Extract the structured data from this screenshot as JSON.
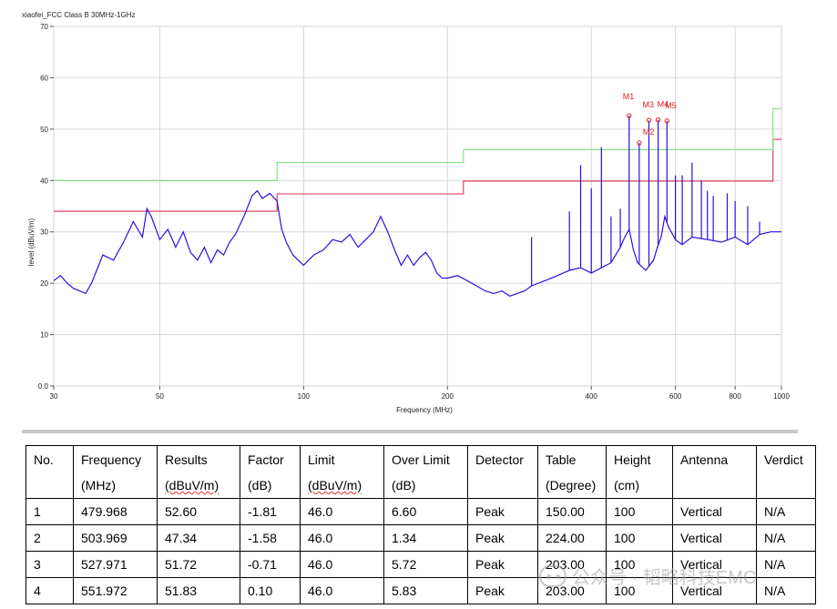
{
  "chart_data": {
    "type": "line",
    "title": "xiaofei_FCC Class B 30MHz-1GHz",
    "xlabel": "Frequency (MHz)",
    "ylabel": "level (dBuV/m)",
    "xscale": "log",
    "xlim": [
      30,
      1000
    ],
    "ylim": [
      0,
      70
    ],
    "grid": true,
    "x_ticks": [
      {
        "value": 30,
        "label": "30"
      },
      {
        "value": 50,
        "label": "50"
      },
      {
        "value": 100,
        "label": "100"
      },
      {
        "value": 200,
        "label": "200"
      },
      {
        "value": 400,
        "label": "400"
      },
      {
        "value": 600,
        "label": "600"
      },
      {
        "value": 800,
        "label": "800"
      },
      {
        "value": 1000,
        "label": "1000"
      }
    ],
    "y_ticks": [
      {
        "value": 0,
        "label": "0.0"
      },
      {
        "value": 10,
        "label": "10"
      },
      {
        "value": 20,
        "label": "20"
      },
      {
        "value": 30,
        "label": "30"
      },
      {
        "value": 40,
        "label": "40"
      },
      {
        "value": 50,
        "label": "50"
      },
      {
        "value": 60,
        "label": "60"
      },
      {
        "value": 70,
        "label": "70"
      }
    ],
    "series": [
      {
        "kind": "limit",
        "color": "#e03050",
        "x": [
          30,
          88,
          88,
          216,
          216,
          960,
          960,
          1000
        ],
        "y": [
          34,
          34,
          37.4,
          37.4,
          39.9,
          39.9,
          48.0,
          48.0
        ]
      },
      {
        "kind": "limit",
        "color": "#7fe07f",
        "x": [
          30,
          88,
          88,
          216,
          216,
          960,
          960,
          1000
        ],
        "y": [
          40,
          40,
          43.5,
          43.5,
          46.0,
          46.0,
          54.0,
          54.0
        ]
      },
      {
        "kind": "trace",
        "color": "#2a10e0",
        "x": [
          30,
          31,
          32,
          33,
          34,
          35,
          36,
          38,
          40,
          42,
          44,
          46,
          47,
          48,
          50,
          52,
          54,
          56,
          58,
          60,
          62,
          64,
          66,
          68,
          70,
          72,
          75,
          78,
          80,
          82,
          85,
          88,
          90,
          92,
          95,
          100,
          105,
          110,
          115,
          120,
          125,
          130,
          135,
          140,
          145,
          150,
          155,
          160,
          165,
          170,
          175,
          180,
          185,
          190,
          195,
          200,
          210,
          220,
          230,
          240,
          250,
          260,
          270,
          280,
          290,
          300,
          320,
          340,
          360,
          380,
          400,
          420,
          440,
          460,
          470,
          480,
          490,
          500,
          520,
          540,
          550,
          560,
          570,
          580,
          600,
          620,
          650,
          700,
          750,
          800,
          850,
          900,
          950,
          1000
        ],
        "y": [
          20.5,
          21.5,
          20.0,
          19.0,
          18.5,
          18.0,
          20.0,
          25.5,
          24.5,
          28.0,
          32.0,
          29.0,
          34.5,
          33.0,
          28.5,
          30.5,
          27.0,
          30.0,
          26.0,
          24.5,
          27.0,
          24.0,
          26.5,
          25.5,
          28.0,
          29.5,
          33.0,
          37.0,
          38.0,
          36.5,
          37.5,
          36.0,
          30.5,
          28.0,
          25.5,
          23.5,
          25.5,
          26.5,
          28.5,
          28.0,
          29.5,
          27.0,
          28.5,
          30.0,
          33.0,
          30.0,
          26.5,
          23.5,
          25.5,
          23.5,
          25.0,
          26.0,
          24.5,
          22.0,
          21.0,
          21.0,
          21.5,
          20.5,
          19.5,
          18.5,
          18.0,
          18.5,
          17.5,
          18.0,
          18.5,
          19.5,
          20.5,
          21.5,
          22.5,
          23.0,
          22.0,
          23.0,
          24.0,
          27.0,
          29.0,
          30.5,
          26.5,
          24.0,
          22.5,
          24.5,
          27.0,
          29.0,
          33.0,
          31.0,
          28.5,
          27.5,
          29.0,
          28.5,
          28.0,
          29.0,
          27.5,
          29.5,
          30.0,
          30.0
        ]
      },
      {
        "kind": "spikes",
        "color": "#2a10e0",
        "x": [
          300,
          360,
          380,
          400,
          420,
          440,
          460,
          480,
          504,
          528,
          552,
          576,
          600,
          620,
          650,
          680,
          700,
          720,
          770,
          800,
          850,
          900
        ],
        "y": [
          29.0,
          34.0,
          43.0,
          38.5,
          46.5,
          33.0,
          34.5,
          52.6,
          47.3,
          51.7,
          51.8,
          51.6,
          41.0,
          41.0,
          43.5,
          40.0,
          38.0,
          37.0,
          37.5,
          36.0,
          35.0,
          32.0
        ]
      }
    ],
    "markers": [
      {
        "label": "M1",
        "x": 479.968,
        "y": 52.6
      },
      {
        "label": "M2",
        "x": 503.969,
        "y": 47.34
      },
      {
        "label": "M3",
        "x": 527.971,
        "y": 51.72
      },
      {
        "label": "M4",
        "x": 551.972,
        "y": 51.83
      },
      {
        "label": "M5",
        "x": 575.974,
        "y": 51.6
      }
    ]
  },
  "table": {
    "headers": [
      {
        "line1": "No.",
        "line2": ""
      },
      {
        "line1": "Frequency",
        "line2": "(MHz)"
      },
      {
        "line1": "Results",
        "line2": "(dBuV/m)"
      },
      {
        "line1": "Factor",
        "line2": "(dB)"
      },
      {
        "line1": "Limit",
        "line2": "(dBuV/m)"
      },
      {
        "line1": "Over Limit",
        "line2": "(dB)"
      },
      {
        "line1": "Detector",
        "line2": ""
      },
      {
        "line1": "Table",
        "line2": "(Degree)"
      },
      {
        "line1": "Height",
        "line2": "(cm)"
      },
      {
        "line1": "Antenna",
        "line2": ""
      },
      {
        "line1": "Verdict",
        "line2": ""
      }
    ],
    "rows": [
      [
        "1",
        "479.968",
        "52.60",
        "-1.81",
        "46.0",
        "6.60",
        "Peak",
        "150.00",
        "100",
        "Vertical",
        "N/A"
      ],
      [
        "2",
        "503.969",
        "47.34",
        "-1.58",
        "46.0",
        "1.34",
        "Peak",
        "224.00",
        "100",
        "Vertical",
        "N/A"
      ],
      [
        "3",
        "527.971",
        "51.72",
        "-0.71",
        "46.0",
        "5.72",
        "Peak",
        "203.00",
        "100",
        "Vertical",
        "N/A"
      ],
      [
        "4",
        "551.972",
        "51.83",
        "0.10",
        "46.0",
        "5.83",
        "Peak",
        "203.00",
        "100",
        "Vertical",
        "N/A"
      ]
    ]
  },
  "watermark": {
    "text": "公众号 · 韬略科技EMC",
    "icon": "wechat-icon"
  }
}
